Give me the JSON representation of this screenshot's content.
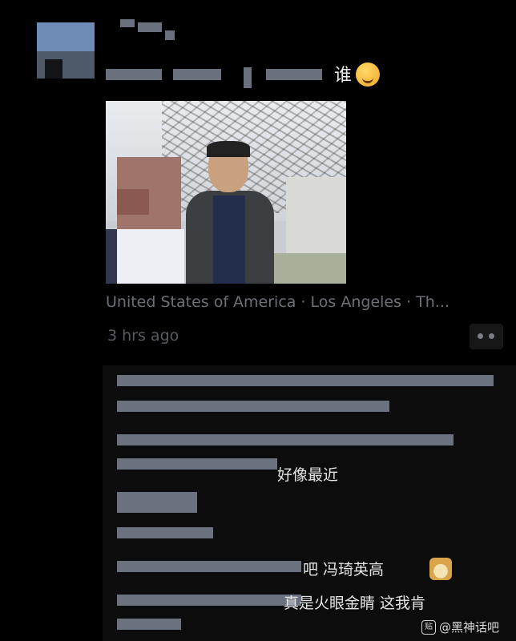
{
  "post": {
    "text_visible": "谁",
    "location": "United States of America · Los Angeles · Th...",
    "time": "3 hrs ago"
  },
  "comments": [
    {
      "text": "好像最近"
    },
    {
      "text": "吧 冯琦英高"
    },
    {
      "text": "真是火眼金睛  这我肯"
    }
  ],
  "watermark": {
    "text": "@黑神话吧",
    "logo": "贴"
  }
}
